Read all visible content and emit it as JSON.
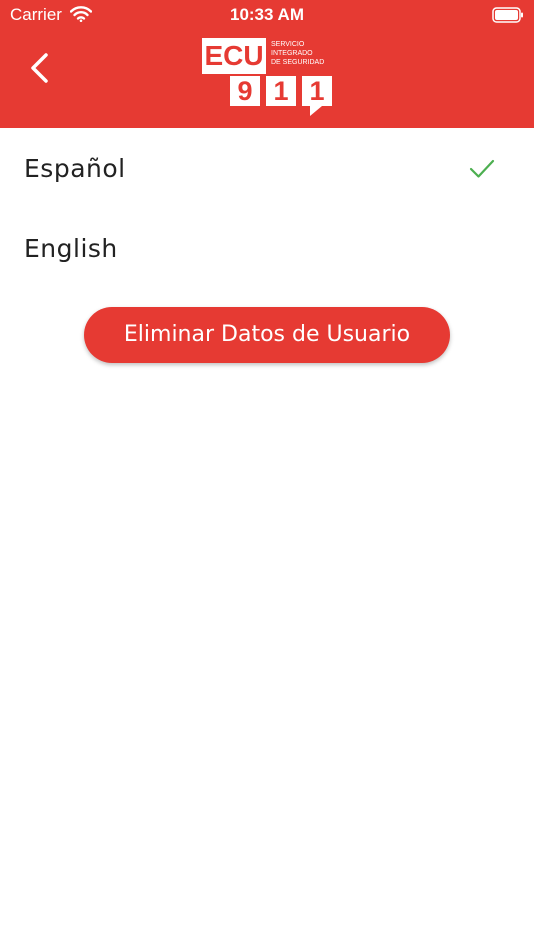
{
  "status_bar": {
    "carrier": "Carrier",
    "time": "10:33 AM"
  },
  "header": {
    "background_color": "#e63a33",
    "back_icon": "chevron-left-icon",
    "logo": {
      "brand": "ECU",
      "digits": [
        "9",
        "1",
        "1"
      ],
      "lines": [
        "SERVICIO",
        "INTEGRADO",
        "DE SEGURIDAD"
      ]
    }
  },
  "languages": {
    "items": [
      {
        "label": "Español",
        "selected": true
      },
      {
        "label": "English",
        "selected": false
      }
    ],
    "check_color": "#4caf50"
  },
  "actions": {
    "delete_user_data_label": "Eliminar Datos de Usuario"
  }
}
